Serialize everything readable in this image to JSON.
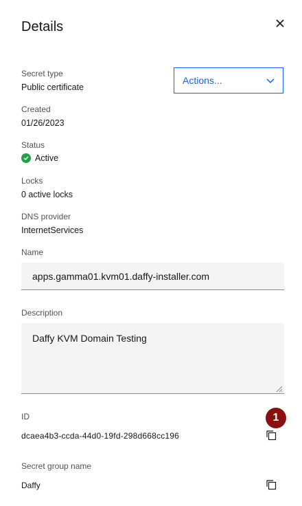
{
  "panel": {
    "title": "Details",
    "close_icon": "close-icon"
  },
  "fields": {
    "secret_type": {
      "label": "Secret type",
      "value": "Public certificate"
    },
    "created": {
      "label": "Created",
      "value": "01/26/2023"
    },
    "status": {
      "label": "Status",
      "value": "Active",
      "color": "#24a148",
      "icon": "checkmark-filled-icon"
    },
    "locks": {
      "label": "Locks",
      "value": "0 active locks"
    },
    "dns_provider": {
      "label": "DNS provider",
      "value": "InternetServices"
    },
    "name": {
      "label": "Name",
      "value": "apps.gamma01.kvm01.daffy-installer.com"
    },
    "description": {
      "label": "Description",
      "value": "Daffy KVM Domain Testing"
    },
    "id": {
      "label": "ID",
      "value": "dcaea4b3-ccda-44d0-19fd-298d668cc196",
      "copy_icon": "copy-icon"
    },
    "secret_group": {
      "label": "Secret group name",
      "value": "Daffy",
      "copy_icon": "copy-icon"
    }
  },
  "actions_dropdown": {
    "label": "Actions...",
    "icon": "chevron-down-icon",
    "color": "#0f62fe"
  },
  "annotation_badge": {
    "text": "1",
    "color": "#8b1111"
  }
}
